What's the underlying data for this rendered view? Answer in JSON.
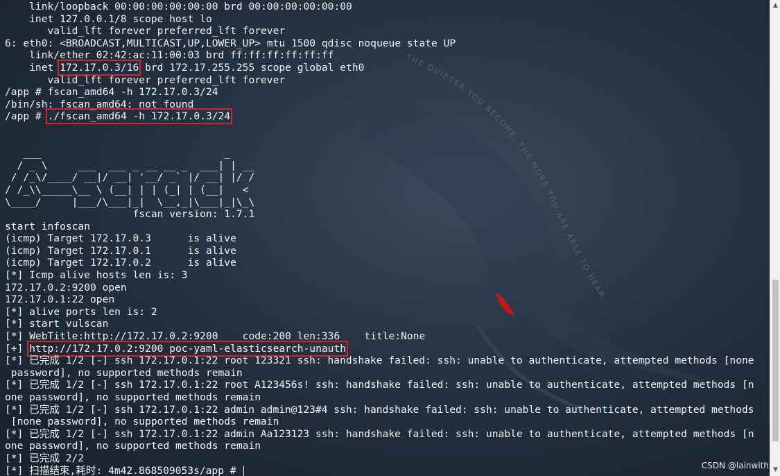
{
  "terminal": {
    "lines": [
      {
        "text": "    link/loopback 00:00:00:00:00:00 brd 00:00:00:00:00:00"
      },
      {
        "text": "    inet 127.0.0.1/8 scope host lo"
      },
      {
        "text": "       valid_lft forever preferred_lft forever"
      },
      {
        "text": "6: eth0: <BROADCAST,MULTICAST,UP,LOWER_UP> mtu 1500 qdisc noqueue state UP"
      },
      {
        "text": "    link/ether 02:42:ac:11:00:03 brd ff:ff:ff:ff:ff:ff"
      },
      {
        "text": "",
        "parts": [
          "    inet ",
          "172.17.0.3/16",
          " brd 172.17.255.255 scope global eth0"
        ]
      },
      {
        "text": "       valid_lft forever preferred_lft forever"
      },
      {
        "text": "/app # fscan_amd64 -h 172.17.0.3/24"
      },
      {
        "text": "/bin/sh: fscan_amd64: not found"
      },
      {
        "text": "",
        "parts": [
          "/app # ",
          "./fscan_amd64 -h 172.17.0.3/24",
          ""
        ]
      },
      {
        "text": ""
      },
      {
        "text": ""
      },
      {
        "text": "   ___                              _"
      },
      {
        "text": "  / _ \\     ___  ___ _ __ __ _  ___| | __"
      },
      {
        "text": " / /_\\/____/ __|/ __| '__/ _` |/ __| |/ /"
      },
      {
        "text": "/ /_\\\\_____\\__ \\ (__| | | (_| | (__|   <"
      },
      {
        "text": "\\____/     |___/\\___|_|  \\__,_|\\___|_|\\_\\"
      },
      {
        "text": "                     fscan version: 1.7.1"
      },
      {
        "text": "start infoscan"
      },
      {
        "text": "(icmp) Target 172.17.0.3      is alive"
      },
      {
        "text": "(icmp) Target 172.17.0.1      is alive"
      },
      {
        "text": "(icmp) Target 172.17.0.2      is alive"
      },
      {
        "text": "[*] Icmp alive hosts len is: 3"
      },
      {
        "text": "172.17.0.2:9200 open"
      },
      {
        "text": "172.17.0.1:22 open"
      },
      {
        "text": "[*] alive ports len is: 2"
      },
      {
        "text": "[*] start vulscan"
      },
      {
        "text": "[*] WebTitle:http://172.17.0.2:9200    code:200 len:336    title:None"
      },
      {
        "text": "",
        "parts": [
          "[+] ",
          "http://172.17.0.2:9200 poc-yaml-elasticsearch-unauth",
          ""
        ]
      },
      {
        "text": "[*] 已完成 1/2 [-] ssh 172.17.0.1:22 root 123321 ssh: handshake failed: ssh: unable to authenticate, attempted methods [none"
      },
      {
        "text": " password], no supported methods remain"
      },
      {
        "text": "[*] 已完成 1/2 [-] ssh 172.17.0.1:22 root A123456s! ssh: handshake failed: ssh: unable to authenticate, attempted methods [n"
      },
      {
        "text": "one password], no supported methods remain"
      },
      {
        "text": "[*] 已完成 1/2 [-] ssh 172.17.0.1:22 admin admin@123#4 ssh: handshake failed: ssh: unable to authenticate, attempted methods"
      },
      {
        "text": " [none password], no supported methods remain"
      },
      {
        "text": "[*] 已完成 1/2 [-] ssh 172.17.0.1:22 admin Aa123123 ssh: handshake failed: ssh: unable to authenticate, attempted methods [n"
      },
      {
        "text": "one password], no supported methods remain"
      },
      {
        "text": "[*] 已完成 2/2"
      },
      {
        "text": "[*] 扫描结束,耗时: 4m42.868509053s/app # "
      }
    ]
  },
  "wallpaper": {
    "slogan": "THE QUIETER YOU BECOME, THE MORE YOU ARE ABLE TO HEAR",
    "eye_color": "#c0161c"
  },
  "highlight_color": "#d0262b",
  "watermark": "CSDN @lainwith",
  "scrollbar": {
    "up_icon": "▲",
    "down_icon": "▼"
  }
}
